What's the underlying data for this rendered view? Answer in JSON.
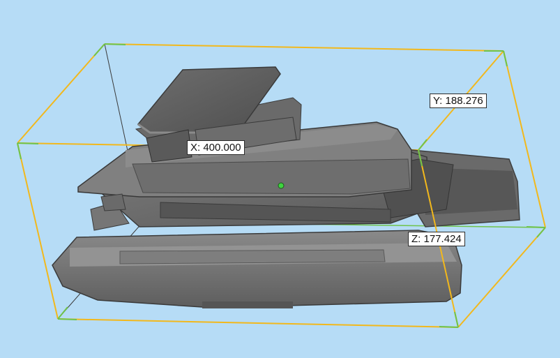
{
  "dimensions": {
    "x_label": "X: 400.000",
    "y_label": "Y: 188.276",
    "z_label": "Z: 177.424"
  },
  "colors": {
    "background": "#b6dcf6",
    "bbox_edge": "#f2b81c",
    "bbox_corner": "#6fc34a",
    "hull": "#7a7a7a",
    "pivot": "#3fd43f"
  }
}
